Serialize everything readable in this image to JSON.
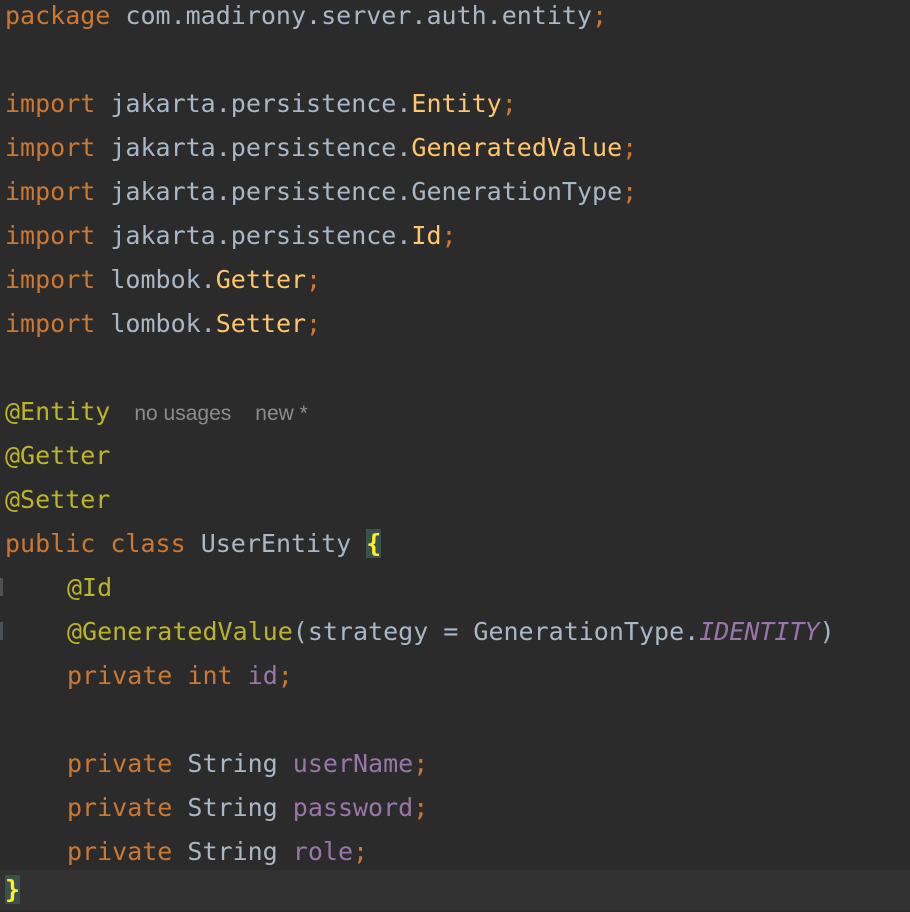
{
  "code": {
    "package_keyword": "package",
    "package_name": "com.madirony.server.auth.entity",
    "semicolon": ";",
    "imports": [
      {
        "keyword": "import",
        "path": "jakarta.persistence.",
        "name": "Entity"
      },
      {
        "keyword": "import",
        "path": "jakarta.persistence.",
        "name": "GeneratedValue"
      },
      {
        "keyword": "import",
        "path": "jakarta.persistence.",
        "name": "GenerationType"
      },
      {
        "keyword": "import",
        "path": "jakarta.persistence.",
        "name": "Id"
      },
      {
        "keyword": "import",
        "path": "lombok.",
        "name": "Getter"
      },
      {
        "keyword": "import",
        "path": "lombok.",
        "name": "Setter"
      }
    ],
    "class_annotations": [
      "@Entity",
      "@Getter",
      "@Setter"
    ],
    "inlay_hints": {
      "usages": "no usages",
      "author": "new *"
    },
    "class_decl": {
      "modifier": "public",
      "keyword": "class",
      "name": "UserEntity",
      "open_brace": "{",
      "close_brace": "}"
    },
    "id_field": {
      "annotation_id": "@Id",
      "annotation_generated": "@GeneratedValue",
      "strategy_open": "(strategy = GenerationType.",
      "strategy_value": "IDENTITY",
      "strategy_close": ")",
      "modifier": "private",
      "type": "int",
      "name": "id"
    },
    "fields": [
      {
        "modifier": "private",
        "type": "String",
        "name": "userName"
      },
      {
        "modifier": "private",
        "type": "String",
        "name": "password"
      },
      {
        "modifier": "private",
        "type": "String",
        "name": "role"
      }
    ]
  },
  "colors": {
    "background": "#2b2b2b",
    "keyword": "#cc7832",
    "annotation": "#bbb529",
    "field": "#9876aa",
    "plain": "#a9b7c6",
    "class_ref": "#ffc66d",
    "hint": "#8c8c8c"
  }
}
